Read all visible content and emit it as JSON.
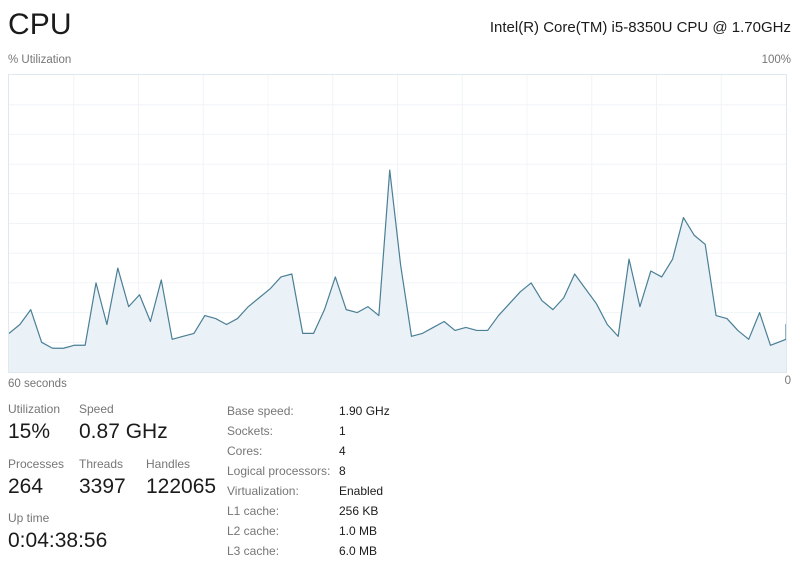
{
  "header": {
    "title": "CPU",
    "model": "Intel(R) Core(TM) i5-8350U CPU @ 1.70GHz"
  },
  "graph": {
    "y_axis_label": "% Utilization",
    "y_axis_max": "100%",
    "x_axis_left": "60 seconds",
    "x_axis_right": "0",
    "line_color": "#4a7f95",
    "fill_color": "#eaf1f7",
    "grid_color": "#f0f4f7",
    "border_color": "#dfe8ef"
  },
  "stats": {
    "utilization": {
      "label": "Utilization",
      "value": "15%"
    },
    "speed": {
      "label": "Speed",
      "value": "0.87 GHz"
    },
    "processes": {
      "label": "Processes",
      "value": "264"
    },
    "threads": {
      "label": "Threads",
      "value": "3397"
    },
    "handles": {
      "label": "Handles",
      "value": "122065"
    },
    "uptime": {
      "label": "Up time",
      "value": "0:04:38:56"
    }
  },
  "specs": [
    {
      "key": "Base speed:",
      "value": "1.90 GHz"
    },
    {
      "key": "Sockets:",
      "value": "1"
    },
    {
      "key": "Cores:",
      "value": "4"
    },
    {
      "key": "Logical processors:",
      "value": "8"
    },
    {
      "key": "Virtualization:",
      "value": "Enabled"
    },
    {
      "key": "L1 cache:",
      "value": "256 KB"
    },
    {
      "key": "L2 cache:",
      "value": "1.0 MB"
    },
    {
      "key": "L3 cache:",
      "value": "6.0 MB"
    }
  ],
  "chart_data": {
    "type": "area",
    "title": "CPU % Utilization over last 60 seconds",
    "xlabel": "60 seconds",
    "ylabel": "% Utilization",
    "xlim": [
      0,
      100
    ],
    "ylim": [
      0,
      100
    ],
    "grid": true,
    "grid_columns": 12,
    "grid_rows": 10,
    "legend": "none",
    "x": [
      0.0,
      1.4,
      2.8,
      4.2,
      5.6,
      7.0,
      8.4,
      9.8,
      11.2,
      12.6,
      14.0,
      15.4,
      16.8,
      18.2,
      19.6,
      21.0,
      22.4,
      23.8,
      25.2,
      26.6,
      28.0,
      29.4,
      30.8,
      32.2,
      33.6,
      35.0,
      36.4,
      37.8,
      39.2,
      40.6,
      42.0,
      43.4,
      44.8,
      46.2,
      47.6,
      49.0,
      50.4,
      51.8,
      53.2,
      54.6,
      56.0,
      57.4,
      58.8,
      60.2,
      61.6,
      63.0,
      64.4,
      65.8,
      67.2,
      68.6,
      70.0,
      71.4,
      72.8,
      74.2,
      75.6,
      77.0,
      78.4,
      79.8,
      81.2,
      82.6,
      84.0,
      85.4,
      86.8,
      88.2,
      89.6,
      91.0,
      92.4,
      93.8,
      95.2,
      96.6,
      98.0,
      100.0
    ],
    "values": [
      13,
      16,
      21,
      10,
      8,
      8,
      9,
      9,
      30,
      16,
      35,
      22,
      26,
      17,
      31,
      11,
      12,
      13,
      19,
      18,
      16,
      18,
      22,
      25,
      28,
      32,
      33,
      13,
      13,
      21,
      32,
      21,
      20,
      22,
      19,
      68,
      36,
      12,
      13,
      15,
      17,
      14,
      15,
      14,
      14,
      19,
      23,
      27,
      30,
      24,
      21,
      25,
      33,
      28,
      23,
      16,
      12,
      38,
      22,
      34,
      32,
      38,
      52,
      46,
      43,
      19,
      18,
      14,
      11,
      20,
      9,
      11,
      16
    ],
    "series": [
      {
        "name": "CPU utilization",
        "color": "#4a7f95",
        "fill": "#eaf1f7"
      }
    ],
    "current_value": 15,
    "current_value_label": "15%"
  }
}
